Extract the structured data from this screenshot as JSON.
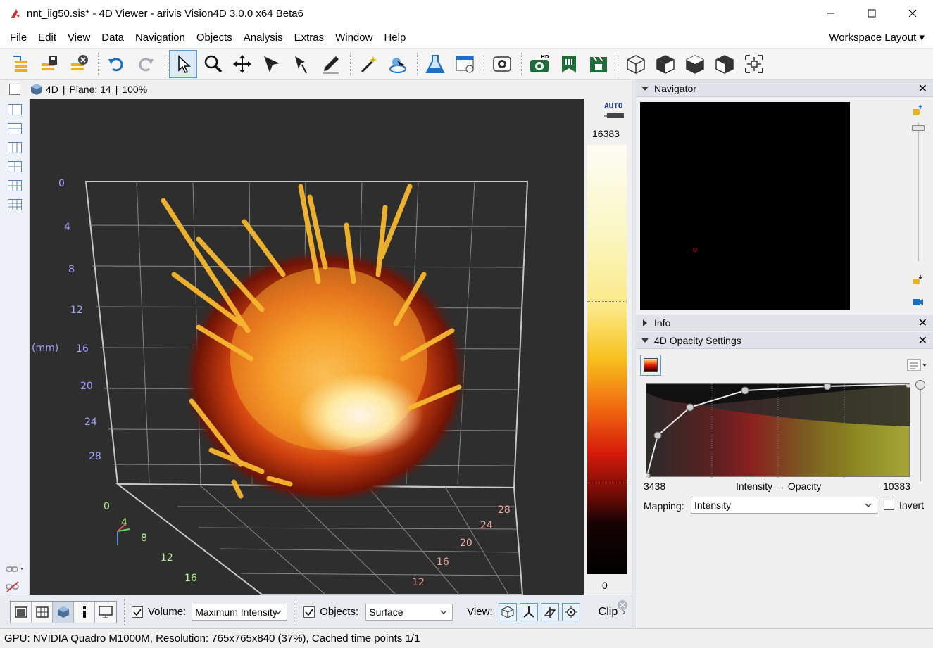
{
  "window": {
    "title": "nnt_iig50.sis* - 4D Viewer - arivis Vision4D 3.0.0 x64 Beta6",
    "accent": "#d9282f"
  },
  "menu": {
    "items": [
      "File",
      "Edit",
      "View",
      "Data",
      "Navigation",
      "Objects",
      "Analysis",
      "Extras",
      "Window",
      "Help"
    ],
    "workspace_label": "Workspace Layout"
  },
  "viewer": {
    "mode_label": "4D",
    "plane_label": "Plane: 14",
    "zoom_label": "100%",
    "sep": "|",
    "axis_unit": "(mm)",
    "y_ticks": [
      "0",
      "4",
      "8",
      "12",
      "16",
      "20",
      "24",
      "28"
    ],
    "x_ticks": [
      "0",
      "4",
      "8",
      "12",
      "16"
    ],
    "z_ticks": [
      "28",
      "24",
      "20",
      "16",
      "12"
    ],
    "colorbar_max": "16383",
    "colorbar_min": "0",
    "auto_label": "AUTO"
  },
  "bottom": {
    "volume_label": "Volume:",
    "volume_mode": "Maximum Intensity",
    "objects_label": "Objects:",
    "objects_mode": "Surface",
    "view_label": "View:",
    "clip_label": "Clip"
  },
  "status": {
    "text": "GPU: NVIDIA Quadro M1000M, Resolution: 765x765x840 (37%), Cached time points 1/1"
  },
  "panels": {
    "navigator_title": "Navigator",
    "info_title": "Info",
    "opacity_title": "4D Opacity Settings",
    "range_min": "3438",
    "range_max": "10383",
    "axis_caption": "Intensity → Opacity",
    "mapping_label": "Mapping:",
    "mapping_value": "Intensity",
    "invert_label": "Invert"
  }
}
